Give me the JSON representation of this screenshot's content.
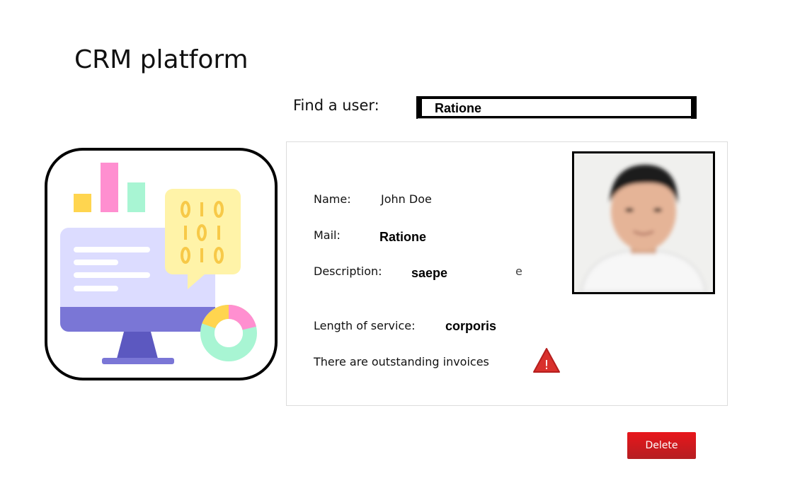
{
  "app": {
    "title": "CRM platform"
  },
  "search": {
    "label": "Find a user:",
    "value": "Ratione"
  },
  "profile": {
    "name_label": "Name:",
    "name_value": "John Doe",
    "mail_label": "Mail:",
    "mail_value": "Ratione",
    "description_label": "Description:",
    "description_value": "saepe",
    "description_trailing_char": "e",
    "service_label": "Length of service:",
    "service_value": "corporis",
    "invoice_notice": "There are outstanding invoices",
    "warning_icon": "warning-triangle-icon",
    "warning_mark": "!"
  },
  "actions": {
    "delete_label": "Delete"
  },
  "colors": {
    "accent_red": "#e8161b",
    "monitor_purple": "#7a76d6",
    "screen_lavender": "#dcdcff",
    "bubble_yellow": "#fff3a8",
    "digit_gold": "#f7c948",
    "pink": "#ff8fd0",
    "mint": "#a8f5d3",
    "yellow": "#ffd54f"
  }
}
